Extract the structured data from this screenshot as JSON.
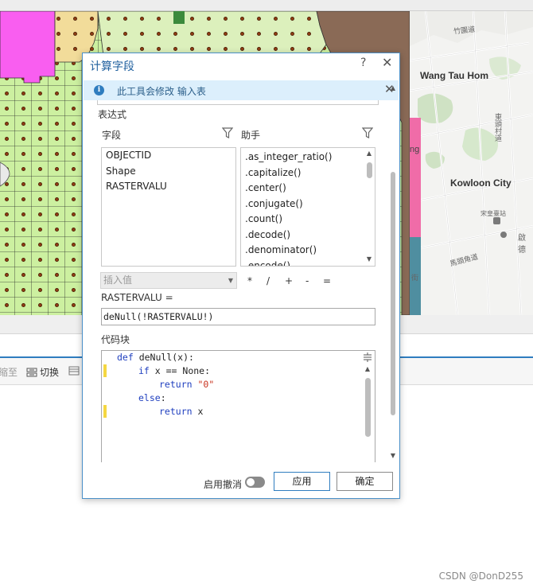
{
  "map": {
    "places": {
      "wang_tau_hom": "Wang Tau Hom",
      "kowloon_city": "Kowloon City",
      "road_1": "竹園道",
      "road_2": "東頭村道",
      "road_3": "宋皇臺站",
      "road_4": "啟德",
      "road_5": "馬頭角道",
      "road_6": "街",
      "partial_ng": "ng"
    }
  },
  "toolbar": {
    "partial_label": "缩至",
    "switch_label": "切换"
  },
  "dialog": {
    "title": "计算字段",
    "help": "?",
    "close": "✕",
    "info": {
      "icon": "i",
      "text": "此工具会修改 输入表",
      "close": "✕"
    },
    "expression_label": "表达式",
    "fields": {
      "label": "字段",
      "items": [
        "OBJECTID",
        "Shape",
        "RASTERVALU"
      ]
    },
    "helper": {
      "label": "助手",
      "items": [
        ".as_integer_ratio()",
        ".capitalize()",
        ".center()",
        ".conjugate()",
        ".count()",
        ".decode()",
        ".denominator()",
        ".encode()"
      ]
    },
    "insert_value": {
      "placeholder": "插入值"
    },
    "operators": [
      "*",
      "/",
      "+",
      "-",
      "="
    ],
    "target_field_label": "RASTERVALU =",
    "expression_value": "deNull(!RASTERVALU!)",
    "code_block": {
      "label": "代码块",
      "line1_kw": "def",
      "line1_rest": " deNull(x):",
      "line2_kw": "if",
      "line2_rest": " x == None:",
      "line3_kw": "return",
      "line3_str": "\"0\"",
      "line4_kw": "else",
      "line4_rest": ":",
      "line5_kw": "return",
      "line5_rest": " x"
    },
    "footer": {
      "enable_undo_label": "启用撤消",
      "apply_label": "应用",
      "ok_label": "确定"
    }
  },
  "watermark": "CSDN @DonD255",
  "colors": {
    "accent": "#2f7dbf",
    "info_bar": "#dceffc",
    "map_pink": "#f95ef0",
    "map_green": "#ccf0a0",
    "map_brown": "#8a6a56",
    "code_keyword": "#1f3fbf",
    "code_string": "#c8321e"
  }
}
